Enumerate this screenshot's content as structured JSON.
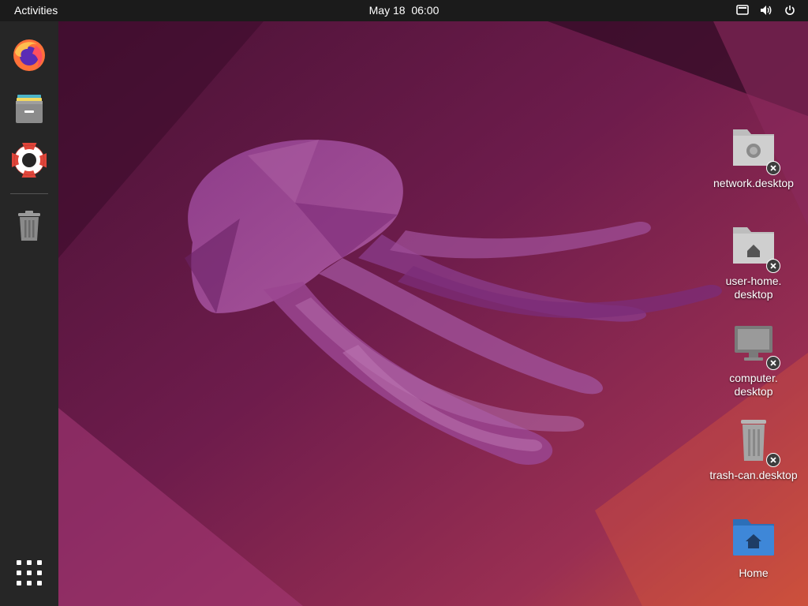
{
  "topbar": {
    "activities_label": "Activities",
    "clock_date": "May 18",
    "clock_time": "06:00",
    "tray_icons": [
      "display-icon",
      "volume-icon",
      "power-icon"
    ]
  },
  "dock": {
    "items": [
      {
        "name": "firefox",
        "icon": "firefox-icon"
      },
      {
        "name": "files",
        "icon": "file-cabinet-icon"
      },
      {
        "name": "help",
        "icon": "lifebuoy-icon"
      },
      {
        "name": "trash",
        "icon": "trash-icon"
      }
    ],
    "app_grid_icon": "app-grid-icon"
  },
  "desktop": {
    "icons": [
      {
        "label": "network.desktop",
        "icon": "network-folder-icon",
        "untrusted": true
      },
      {
        "label": "user-home.\ndesktop",
        "icon": "home-folder-icon",
        "untrusted": true
      },
      {
        "label": "computer.\ndesktop",
        "icon": "computer-icon",
        "untrusted": true
      },
      {
        "label": "trash-can.desktop",
        "icon": "trash-icon",
        "untrusted": true
      },
      {
        "label": "Home",
        "icon": "home-folder-icon",
        "untrusted": false
      }
    ]
  },
  "colors": {
    "topbar_bg": "#1b1b1b",
    "dock_bg": "#262626",
    "wallpaper_dark": "#3a0d2a",
    "wallpaper_mid": "#7a1f54",
    "wallpaper_warm": "#c24a3a",
    "jellyfish": "#9b3c86",
    "home_folder": "#3e87d8"
  }
}
